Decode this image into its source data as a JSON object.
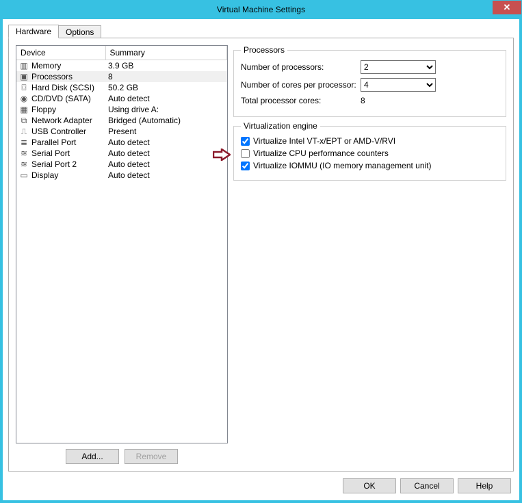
{
  "title": "Virtual Machine Settings",
  "close_glyph": "✕",
  "tabs": {
    "hardware": "Hardware",
    "options": "Options"
  },
  "table": {
    "col_device": "Device",
    "col_summary": "Summary",
    "rows": [
      {
        "name": "Memory",
        "summary": "3.9 GB",
        "icon": "memory"
      },
      {
        "name": "Processors",
        "summary": "8",
        "icon": "cpu",
        "selected": true
      },
      {
        "name": "Hard Disk (SCSI)",
        "summary": "50.2 GB",
        "icon": "disk"
      },
      {
        "name": "CD/DVD (SATA)",
        "summary": "Auto detect",
        "icon": "cd"
      },
      {
        "name": "Floppy",
        "summary": "Using drive A:",
        "icon": "floppy"
      },
      {
        "name": "Network Adapter",
        "summary": "Bridged (Automatic)",
        "icon": "net"
      },
      {
        "name": "USB Controller",
        "summary": "Present",
        "icon": "usb"
      },
      {
        "name": "Parallel Port",
        "summary": "Auto detect",
        "icon": "parallel"
      },
      {
        "name": "Serial Port",
        "summary": "Auto detect",
        "icon": "serial"
      },
      {
        "name": "Serial Port 2",
        "summary": "Auto detect",
        "icon": "serial"
      },
      {
        "name": "Display",
        "summary": "Auto detect",
        "icon": "display"
      }
    ]
  },
  "left_buttons": {
    "add": "Add...",
    "remove": "Remove"
  },
  "processors_box": {
    "legend": "Processors",
    "num_proc_label": "Number of processors:",
    "num_proc_value": "2",
    "cores_label": "Number of cores per processor:",
    "cores_value": "4",
    "total_label": "Total processor cores:",
    "total_value": "8"
  },
  "virt_box": {
    "legend": "Virtualization engine",
    "vt_label": "Virtualize Intel VT-x/EPT or AMD-V/RVI",
    "vt_checked": true,
    "perf_label": "Virtualize CPU performance counters",
    "perf_checked": false,
    "iommu_label": "Virtualize IOMMU (IO memory management unit)",
    "iommu_checked": true
  },
  "footer": {
    "ok": "OK",
    "cancel": "Cancel",
    "help": "Help"
  },
  "icons": {
    "memory": "▥",
    "cpu": "▣",
    "disk": "⌼",
    "cd": "◉",
    "floppy": "▦",
    "net": "⧉",
    "usb": "⎍",
    "parallel": "≣",
    "serial": "≋",
    "display": "▭"
  }
}
